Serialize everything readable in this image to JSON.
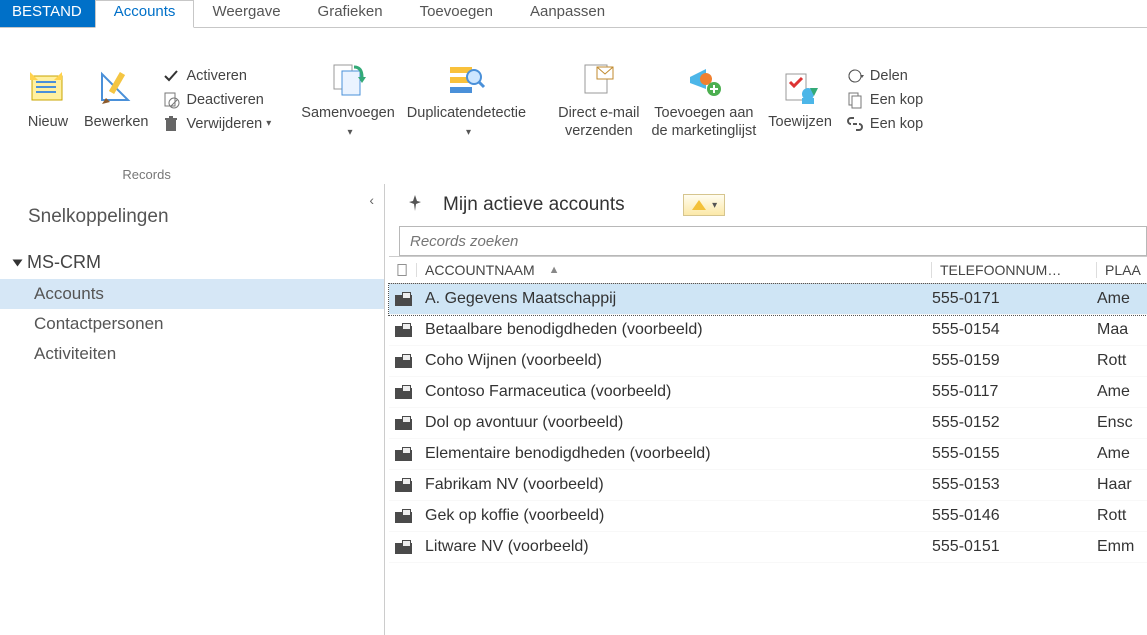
{
  "tabs": {
    "file": "BESTAND",
    "items": [
      "Accounts",
      "Weergave",
      "Grafieken",
      "Toevoegen",
      "Aanpassen"
    ],
    "active_index": 0
  },
  "ribbon": {
    "records_group_label": "Records",
    "new": "Nieuw",
    "edit": "Bewerken",
    "activate": "Activeren",
    "deactivate": "Deactiveren",
    "delete": "Verwijderen",
    "merge_l1": "Samenvoegen",
    "duplicate": "Duplicatendetectie",
    "direct_email_l1": "Direct e-mail",
    "direct_email_l2": "verzenden",
    "add_marketing_l1": "Toevoegen aan",
    "add_marketing_l2": "de marketinglijst",
    "assign": "Toewijzen",
    "share": "Delen",
    "copy1": "Een kop",
    "copy2": "Een kop"
  },
  "sidebar": {
    "shortcuts": "Snelkoppelingen",
    "tree_root": "MS-CRM",
    "items": [
      {
        "label": "Accounts",
        "selected": true
      },
      {
        "label": "Contactpersonen",
        "selected": false
      },
      {
        "label": "Activiteiten",
        "selected": false
      }
    ]
  },
  "view": {
    "title": "Mijn actieve accounts",
    "search_placeholder": "Records zoeken"
  },
  "columns": {
    "name": "ACCOUNTNAAM",
    "phone": "TELEFOONNUM…",
    "city": "PLAA"
  },
  "rows": [
    {
      "name": "A. Gegevens Maatschappij",
      "phone": "555-0171",
      "city": "Ame",
      "selected": true
    },
    {
      "name": "Betaalbare benodigdheden (voorbeeld)",
      "phone": "555-0154",
      "city": "Maa",
      "selected": false
    },
    {
      "name": "Coho Wijnen (voorbeeld)",
      "phone": "555-0159",
      "city": "Rott",
      "selected": false
    },
    {
      "name": "Contoso Farmaceutica (voorbeeld)",
      "phone": "555-0117",
      "city": "Ame",
      "selected": false
    },
    {
      "name": "Dol op avontuur (voorbeeld)",
      "phone": "555-0152",
      "city": "Ensc",
      "selected": false
    },
    {
      "name": "Elementaire benodigdheden (voorbeeld)",
      "phone": "555-0155",
      "city": "Ame",
      "selected": false
    },
    {
      "name": "Fabrikam NV (voorbeeld)",
      "phone": "555-0153",
      "city": "Haar",
      "selected": false
    },
    {
      "name": "Gek op koffie (voorbeeld)",
      "phone": "555-0146",
      "city": "Rott",
      "selected": false
    },
    {
      "name": "Litware NV (voorbeeld)",
      "phone": "555-0151",
      "city": "Emm",
      "selected": false
    }
  ]
}
